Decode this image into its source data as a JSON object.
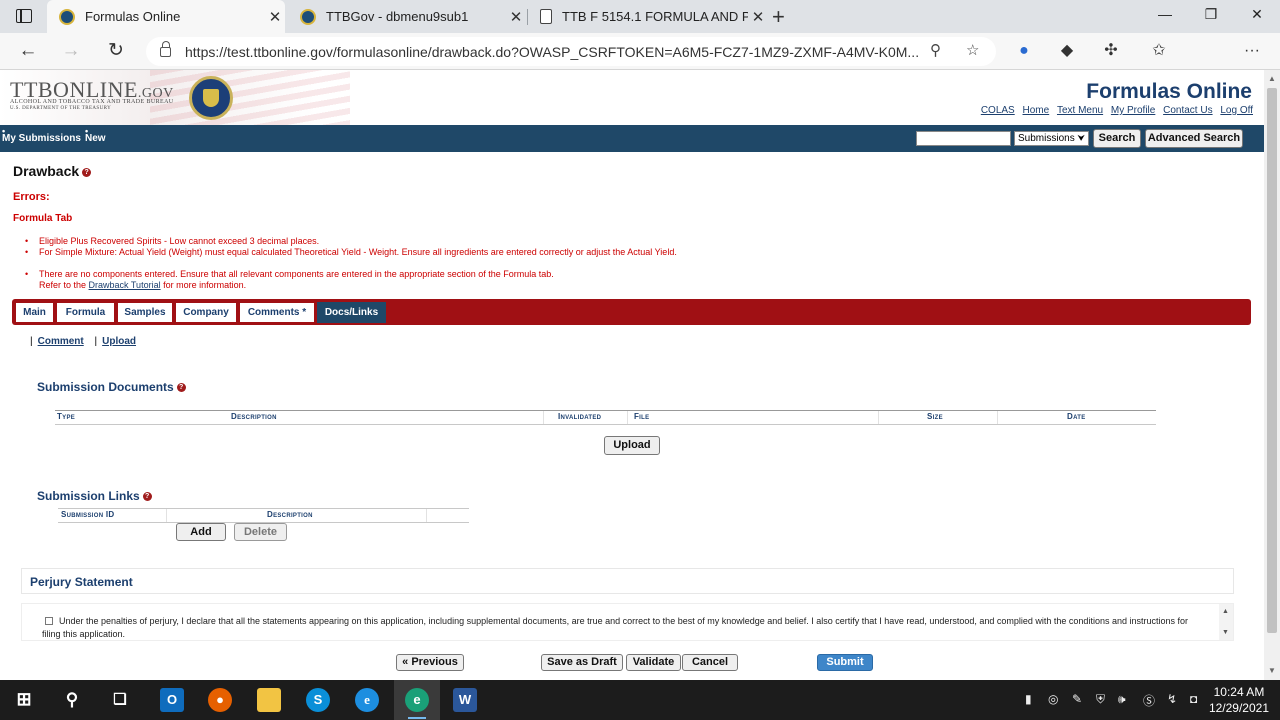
{
  "browser": {
    "tabs": [
      {
        "label": "Formulas Online",
        "active": true
      },
      {
        "label": "TTBGov - dbmenu9sub1",
        "active": false
      },
      {
        "label": "TTB F 5154.1 FORMULA AND PR",
        "active": false
      }
    ],
    "url": "https://test.ttbonline.gov/formulasonline/drawback.do?OWASP_CSRFTOKEN=A6M5-FCZ7-1MZ9-ZXMF-A4MV-K0M..."
  },
  "site": {
    "logo_main": "TTBONLINE",
    "logo_gov": ".GOV",
    "logo_sub1": "ALCOHOL AND TOBACCO TAX AND TRADE BUREAU",
    "logo_sub2": "U.S. DEPARTMENT OF THE TREASURY",
    "title": "Formulas Online",
    "top_links": [
      "COLAS",
      "Home",
      "Text Menu",
      "My Profile",
      "Contact Us",
      "Log Off"
    ]
  },
  "nav": {
    "my_submissions": "My Submissions",
    "new": "New",
    "search_select": "Submissions",
    "search_button": "Search",
    "advanced_search_button": "Advanced Search"
  },
  "page": {
    "heading": "Drawback",
    "errors_title": "Errors:",
    "errors_tab": "Formula Tab",
    "errors": [
      "Eligible Plus Recovered Spirits - Low cannot exceed 3 decimal places.",
      "For Simple Mixture: Actual Yield (Weight) must equal calculated Theoretical Yield - Weight. Ensure all ingredients are entered correctly or adjust the Actual Yield.",
      "There are no components entered. Ensure that all relevant components are entered in the appropriate section of the Formula tab."
    ],
    "refer_prefix": "Refer to the",
    "refer_link": "Drawback Tutorial",
    "refer_suffix": "for more information.",
    "tabs": [
      "Main",
      "Formula",
      "Samples",
      "Company",
      "Comments *",
      "Docs/Links"
    ],
    "active_tab": "Docs/Links",
    "sublinks": [
      "Comment",
      "Upload"
    ]
  },
  "documents": {
    "title": "Submission Documents",
    "columns": [
      "Type",
      "Description",
      "Invalidated",
      "File",
      "Size",
      "Date"
    ],
    "rows": [],
    "upload_button": "Upload"
  },
  "links": {
    "title": "Submission Links",
    "columns": [
      "Submission ID",
      "Description"
    ],
    "rows": [],
    "add_button": "Add",
    "delete_button": "Delete"
  },
  "perjury": {
    "title": "Perjury Statement",
    "text": "Under the penalties of perjury, I declare that all the statements appearing on this application, including supplemental documents, are true and correct to the best of my knowledge and belief. I also certify that I have read, understood, and complied with the conditions and instructions for filing this application.",
    "checked": false
  },
  "actions": {
    "previous": "« Previous",
    "save_draft": "Save as Draft",
    "validate": "Validate",
    "cancel": "Cancel",
    "submit": "Submit"
  },
  "taskbar": {
    "time": "10:24 AM",
    "date": "12/29/2021"
  },
  "colors": {
    "nav_blue": "#1f4868",
    "tab_red": "#a01014",
    "error_red": "#cc0000",
    "link_blue": "#1c3f6e"
  }
}
